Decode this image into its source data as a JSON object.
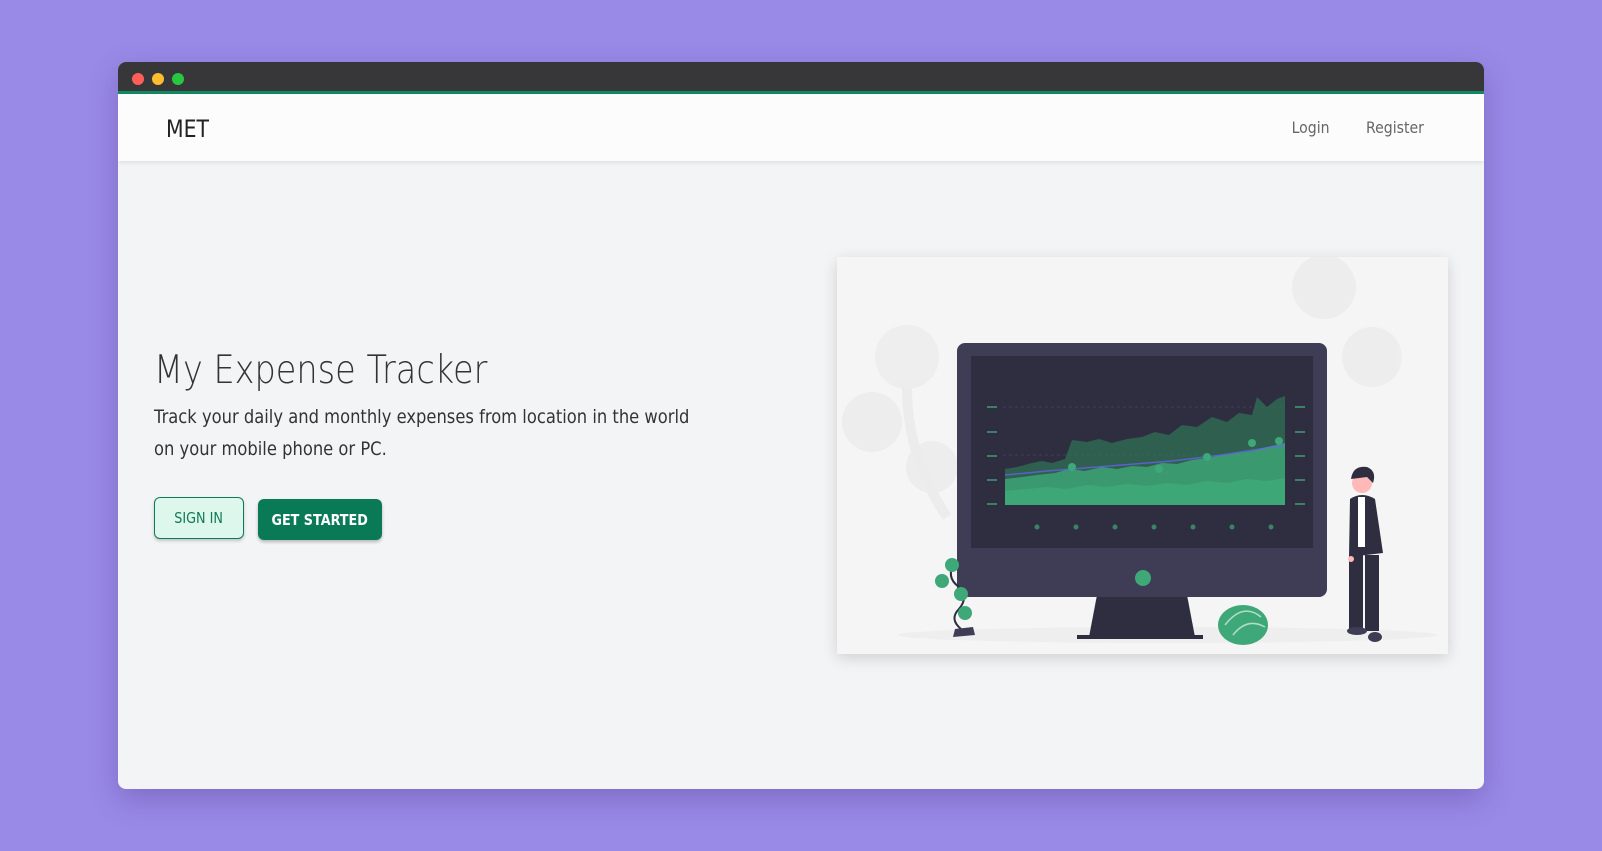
{
  "navbar": {
    "brand": "MET",
    "links": [
      {
        "label": "Login"
      },
      {
        "label": "Register"
      }
    ]
  },
  "hero": {
    "title": "My Expense Tracker",
    "subtitle": "Track your daily and monthly expenses from location in the world on your mobile phone or PC.",
    "signin_label": "SIGN IN",
    "get_started_label": "GET STARTED"
  },
  "colors": {
    "page_background": "#9a8ae8",
    "titlebar": "#37373a",
    "accent": "#0a7a56",
    "signin_bg": "#ddf7ec",
    "window_bg": "#f3f4f6"
  },
  "illustration": {
    "icon": "monitor-chart-illustration"
  }
}
